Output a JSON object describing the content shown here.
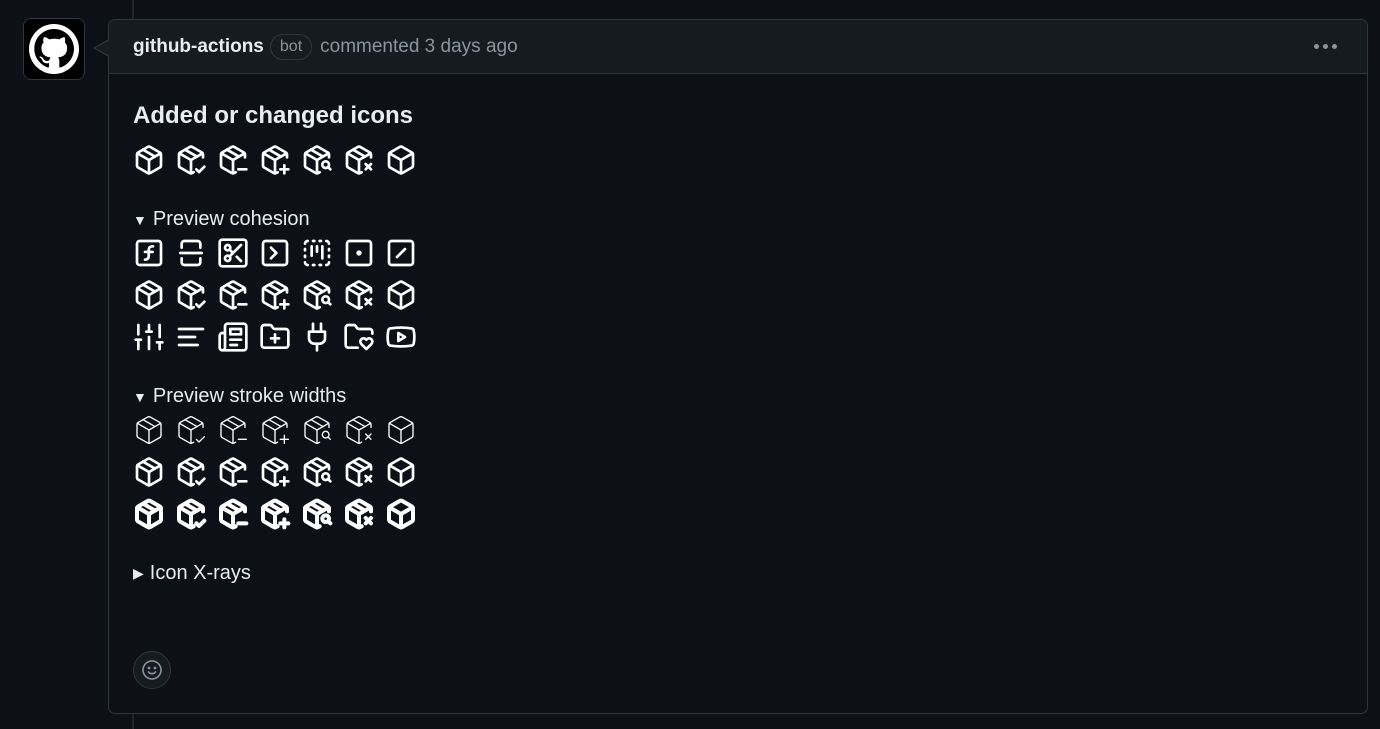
{
  "comment": {
    "author": "github-actions",
    "badge": "bot",
    "meta": "commented 3 days ago"
  },
  "body": {
    "heading": "Added or changed icons",
    "sections": [
      {
        "summary": "Preview cohesion",
        "open": true
      },
      {
        "summary": "Preview stroke widths",
        "open": true
      },
      {
        "summary": "Icon X-rays",
        "open": false
      }
    ],
    "changed_icons": [
      "package-icon",
      "package-check-icon",
      "package-minus-icon",
      "package-plus-icon",
      "package-search-icon",
      "package-x-icon",
      "package-open-icon"
    ],
    "cohesion_rows": [
      [
        "square-function-icon",
        "square-split-vertical-icon",
        "square-scissors-icon",
        "square-terminal-icon",
        "square-dashed-kanban-icon",
        "square-dot-icon",
        "square-slash-icon"
      ],
      [
        "package-icon",
        "package-check-icon",
        "package-minus-icon",
        "package-plus-icon",
        "package-search-icon",
        "package-x-icon",
        "package-open-icon"
      ],
      [
        "sliders-vertical-icon",
        "align-left-icon",
        "newspaper-icon",
        "folder-plus-icon",
        "plug-icon",
        "folder-heart-icon",
        "youtube-icon"
      ]
    ],
    "stroke_widths": [
      1,
      2,
      3
    ]
  },
  "colors": {
    "background": "#0d1117",
    "header": "#161b22",
    "border": "#30363d",
    "muted": "#8b949e",
    "text": "#e6edf3"
  }
}
